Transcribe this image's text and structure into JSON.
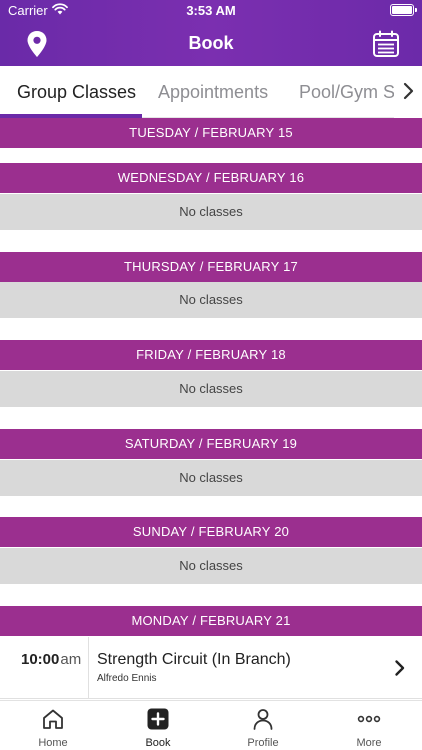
{
  "status_bar": {
    "carrier": "Carrier",
    "time": "3:53 AM"
  },
  "nav": {
    "title": "Book",
    "left_icon": "location-pin-icon",
    "right_icon": "calendar-icon"
  },
  "tabs": [
    {
      "label": "Group Classes",
      "active": true
    },
    {
      "label": "Appointments",
      "active": false
    },
    {
      "label": "Pool/Gym Sc",
      "active": false
    }
  ],
  "schedule": {
    "days": [
      {
        "header": "TUESDAY / FEBRUARY 15"
      },
      {
        "header": "WEDNESDAY / FEBRUARY 16",
        "empty_text": "No classes"
      },
      {
        "header": "THURSDAY / FEBRUARY 17",
        "empty_text": "No classes"
      },
      {
        "header": "FRIDAY / FEBRUARY 18",
        "empty_text": "No classes"
      },
      {
        "header": "SATURDAY / FEBRUARY 19",
        "empty_text": "No classes"
      },
      {
        "header": "SUNDAY / FEBRUARY 20",
        "empty_text": "No classes"
      },
      {
        "header": "MONDAY / FEBRUARY 21"
      }
    ],
    "class": {
      "time": "10:00",
      "ampm": "am",
      "name": "Strength Circuit (In Branch)",
      "instructor": "Alfredo Ennis"
    }
  },
  "tab_bar": [
    {
      "label": "Home",
      "icon": "home-icon"
    },
    {
      "label": "Book",
      "icon": "plus-square-icon",
      "active": true
    },
    {
      "label": "Profile",
      "icon": "person-icon"
    },
    {
      "label": "More",
      "icon": "ellipsis-icon"
    }
  ],
  "colors": {
    "brand_purple": "#6a2aa8",
    "day_header": "#9b2f8f",
    "empty_row": "#d9d9d9"
  }
}
